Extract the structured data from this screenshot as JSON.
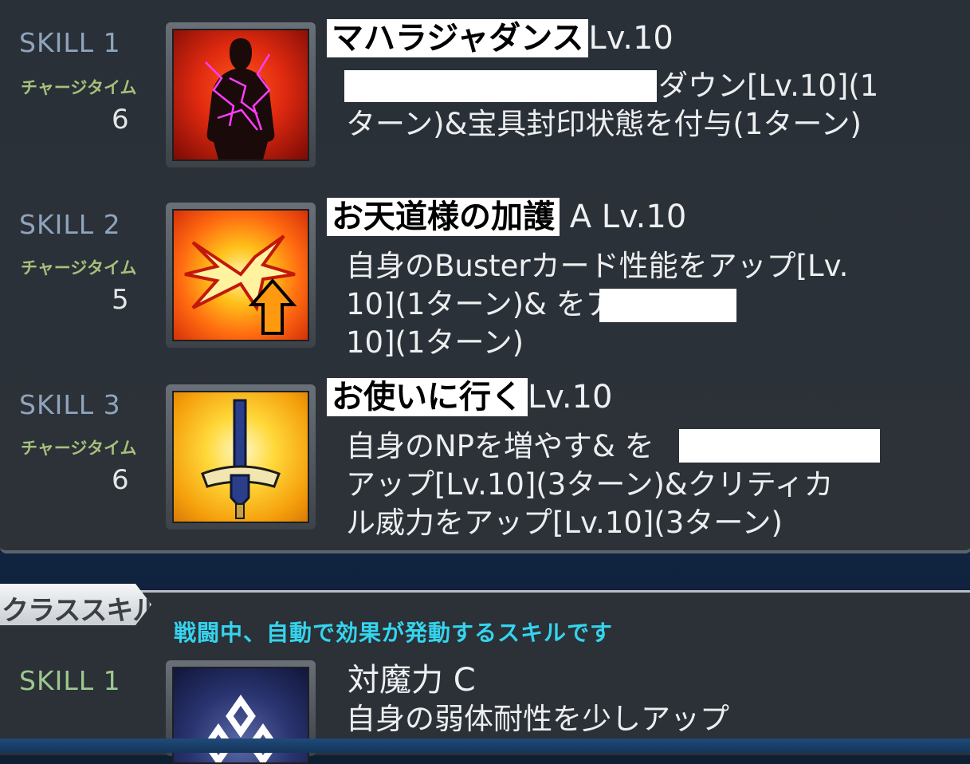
{
  "active_skills": [
    {
      "slot_label": "SKILL 1",
      "charge_label": "チャージタイム",
      "charge_value": "6",
      "name": "マハラジャダンス",
      "rank": "Lv.10",
      "description": "ダウン[Lv.10](1\nターン)&宝具封印状態を付与(1ターン)",
      "icon": "cursed-silhouette-icon"
    },
    {
      "slot_label": "SKILL 2",
      "charge_label": "チャージタイム",
      "charge_value": "5",
      "name": "お天道様の加護",
      "rank": "A Lv.10",
      "description": "自身のBusterカード性能をアップ[Lv.\n10](1ターン)&                    をアップ[Lv.\n10](1ターン)",
      "icon": "buster-up-icon"
    },
    {
      "slot_label": "SKILL 3",
      "charge_label": "チャージタイム",
      "charge_value": "6",
      "name": "お使いに行く",
      "rank": "Lv.10",
      "description": "自身のNPを増やす&                        を\nアップ[Lv.10](3ターン)&クリティカ\nル威力をアップ[Lv.10](3ターン)",
      "icon": "sword-icon"
    }
  ],
  "class_skills": {
    "tab_label": "クラススキル",
    "info_text": "戦闘中、自動で効果が発動するスキルです",
    "items": [
      {
        "slot_label": "SKILL 1",
        "name": "対魔力 C",
        "description": "自身の弱体耐性を少しアップ",
        "icon": "magic-resistance-icon"
      }
    ]
  },
  "colors": {
    "skill_label": "#8fa4bd",
    "charge_label": "#a7c07d",
    "info_text": "#35d4ee"
  }
}
